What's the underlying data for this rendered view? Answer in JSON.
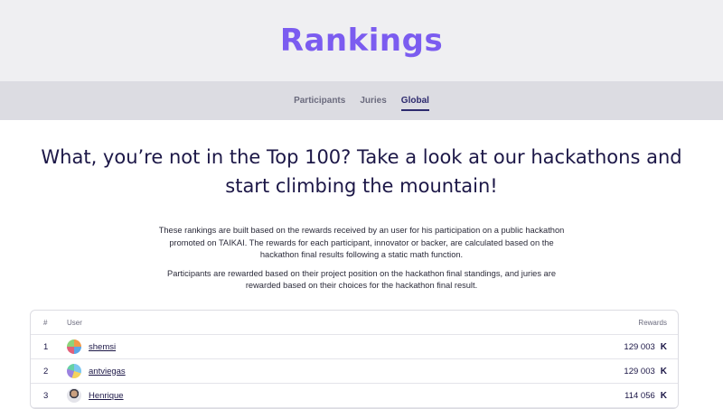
{
  "hero": {
    "title": "Rankings"
  },
  "tabs": [
    {
      "label": "Participants"
    },
    {
      "label": "Juries"
    },
    {
      "label": "Global"
    }
  ],
  "headline": "What, you’re not in the Top 100? Take a look at our hackathons and start climbing the mountain!",
  "description": {
    "p1": "These rankings are built based on the rewards received by an user for his participation on a public hackathon promoted on TAIKAI. The rewards for each participant, innovator or backer, are calculated based on the hackathon final results following a static math function.",
    "p2": "Participants are rewarded based on their project position on the hackathon final standings, and juries are rewarded based on their choices for the hackathon final result."
  },
  "table": {
    "headers": {
      "rank": "#",
      "user": "User",
      "rewards": "Rewards"
    },
    "rows": [
      {
        "rank": "1",
        "user": "shemsi",
        "rewards": "129 003",
        "token": "K"
      },
      {
        "rank": "2",
        "user": "antviegas",
        "rewards": "129 003",
        "token": "K"
      },
      {
        "rank": "3",
        "user": "Henrique",
        "rewards": "114 056",
        "token": "K"
      }
    ]
  }
}
